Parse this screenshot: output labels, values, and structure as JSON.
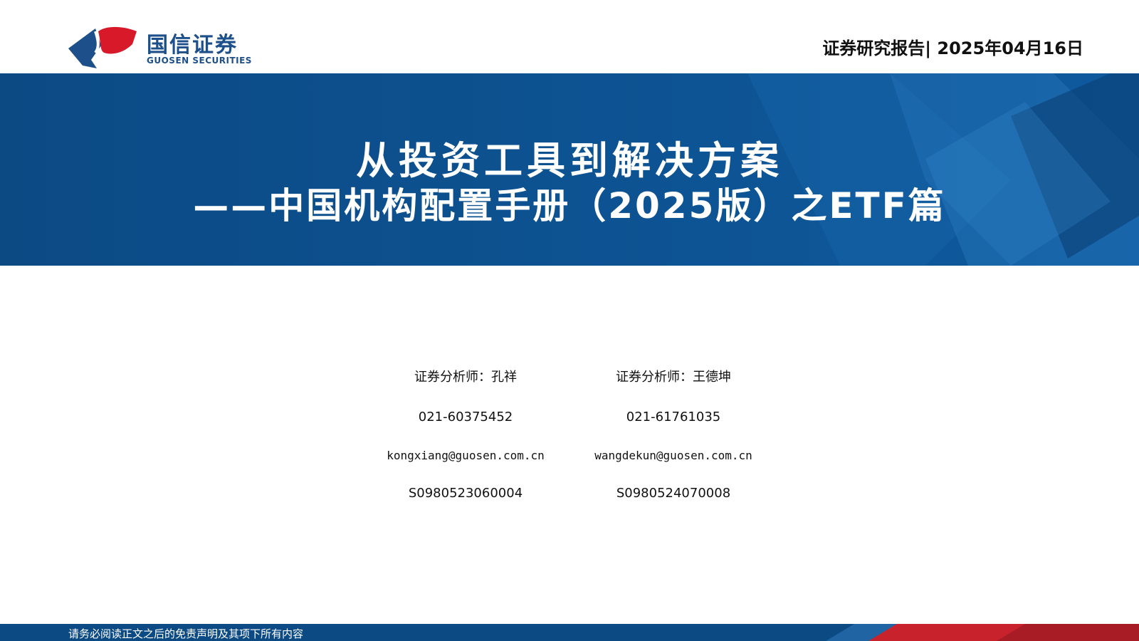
{
  "header": {
    "logo_cn": "国信证券",
    "logo_en": "GUOSEN SECURITIES",
    "report_meta": "证券研究报告| 2025年04月16日"
  },
  "banner": {
    "title_line1": "从投资工具到解决方案",
    "title_line2": "——中国机构配置手册（2025版）之ETF篇"
  },
  "analysts": [
    {
      "label": "证券分析师：孔祥",
      "phone": "021-60375452",
      "email": "kongxiang@guosen.com.cn",
      "cert": "S0980523060004"
    },
    {
      "label": "证券分析师：王德坤",
      "phone": "021-61761035",
      "email": "wangdekun@guosen.com.cn",
      "cert": "S0980524070008"
    }
  ],
  "footer": {
    "disclaimer": "请务必阅读正文之后的免责声明及其项下所有内容"
  },
  "colors": {
    "brand_blue": "#0c4a84",
    "logo_red": "#d7192a",
    "logo_blue": "#1d4f8a"
  }
}
